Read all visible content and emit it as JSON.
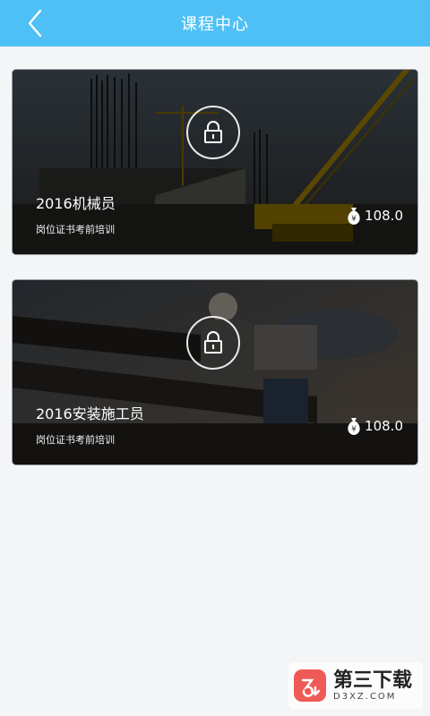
{
  "header": {
    "title": "课程中心",
    "back_icon": "chevron-left-icon",
    "color": "#4fc0f5"
  },
  "courses": [
    {
      "title": "2016机械员",
      "subtitle": "岗位证书考前培训",
      "price": "108.0",
      "locked": true,
      "lock_icon": "lock-icon",
      "price_icon": "money-bag-icon",
      "background": "construction-crane-photo"
    },
    {
      "title": "2016安装施工员",
      "subtitle": "岗位证书考前培训",
      "price": "108.0",
      "locked": true,
      "lock_icon": "lock-icon",
      "price_icon": "money-bag-icon",
      "background": "construction-worker-photo"
    }
  ],
  "watermark": {
    "brand": "第三下载",
    "domain": "D3XZ.COM",
    "logo_color": "#f05a56"
  }
}
